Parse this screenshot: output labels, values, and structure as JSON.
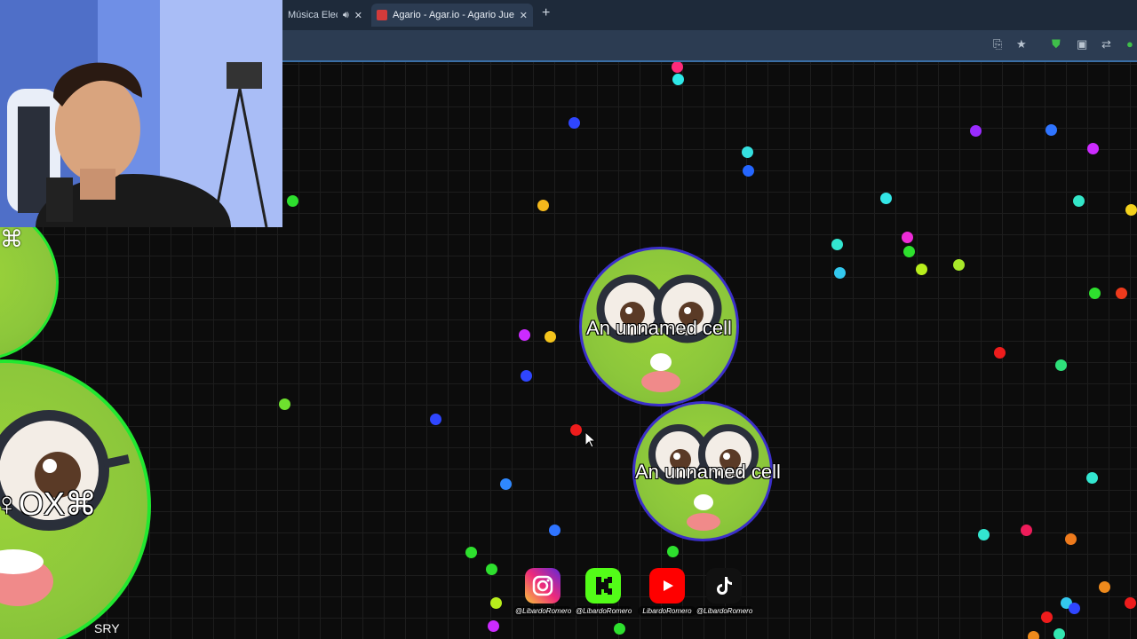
{
  "browser": {
    "tabs": [
      {
        "label": "Música Electr",
        "active": false
      },
      {
        "label": "Agario - Agar.io - Agario Juego",
        "active": true
      }
    ],
    "new_tab_icon": "plus-icon",
    "toolbar_icons": [
      "install-icon",
      "star-icon",
      "shield-icon",
      "extension-icon",
      "media-icon"
    ]
  },
  "colors": {
    "accent_tab": "#2c3c52",
    "cell_green": "#8cc73b",
    "cell_border_blue": "#3b2fc9",
    "big_cell_border": "#22e830"
  },
  "game": {
    "player_cells": [
      {
        "name": "An unnamed cell"
      },
      {
        "name": "An unnamed cell"
      }
    ],
    "enemy_cell_name": "♀OX⌘",
    "bottom_label": "SRY"
  },
  "socials": [
    {
      "icon": "instagram-icon",
      "handle": "@LibardoRomero"
    },
    {
      "icon": "kick-icon",
      "handle": "@LibardoRomero"
    },
    {
      "icon": "youtube-icon",
      "handle": "LibardoRomero"
    },
    {
      "icon": "tiktok-icon",
      "handle": "@LibardoRomero"
    }
  ]
}
